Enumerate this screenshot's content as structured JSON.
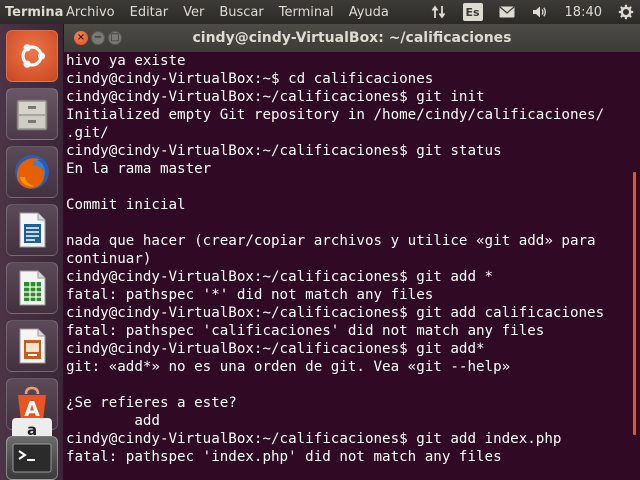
{
  "top_panel": {
    "app_title": "Terminal",
    "menu": [
      "Archivo",
      "Editar",
      "Ver",
      "Buscar",
      "Terminal",
      "Ayuda"
    ],
    "keyboard_layout": "Es",
    "clock": "18:40"
  },
  "launcher": {
    "items": [
      {
        "name": "ubuntu-dash-icon"
      },
      {
        "name": "files-icon"
      },
      {
        "name": "firefox-icon"
      },
      {
        "name": "libreoffice-writer-icon"
      },
      {
        "name": "libreoffice-calc-icon"
      },
      {
        "name": "libreoffice-impress-icon"
      },
      {
        "name": "software-center-icon"
      },
      {
        "name": "amazon-icon"
      },
      {
        "name": "terminal-icon"
      }
    ]
  },
  "window": {
    "title": "cindy@cindy-VirtualBox: ~/calificaciones",
    "close_glyph": "×",
    "minimize_glyph": "−",
    "maximize_glyph": "□"
  },
  "terminal": {
    "lines": [
      "hivo ya existe",
      "cindy@cindy-VirtualBox:~$ cd calificaciones",
      "cindy@cindy-VirtualBox:~/calificaciones$ git init",
      "Initialized empty Git repository in /home/cindy/calificaciones/",
      ".git/",
      "cindy@cindy-VirtualBox:~/calificaciones$ git status",
      "En la rama master",
      "",
      "Commit inicial",
      "",
      "nada que hacer (crear/copiar archivos y utilice «git add» para",
      "continuar)",
      "cindy@cindy-VirtualBox:~/calificaciones$ git add *",
      "fatal: pathspec '*' did not match any files",
      "cindy@cindy-VirtualBox:~/calificaciones$ git add calificaciones",
      "fatal: pathspec 'calificaciones' did not match any files",
      "cindy@cindy-VirtualBox:~/calificaciones$ git add*",
      "git: «add*» no es una orden de git. Vea «git --help»",
      "",
      "¿Se refieres a este?",
      "        add",
      "cindy@cindy-VirtualBox:~/calificaciones$ git add index.php",
      "fatal: pathspec 'index.php' did not match any files"
    ]
  },
  "colors": {
    "terminal_bg": "#300a24",
    "accent": "#e95420",
    "text": "#ffffff"
  }
}
